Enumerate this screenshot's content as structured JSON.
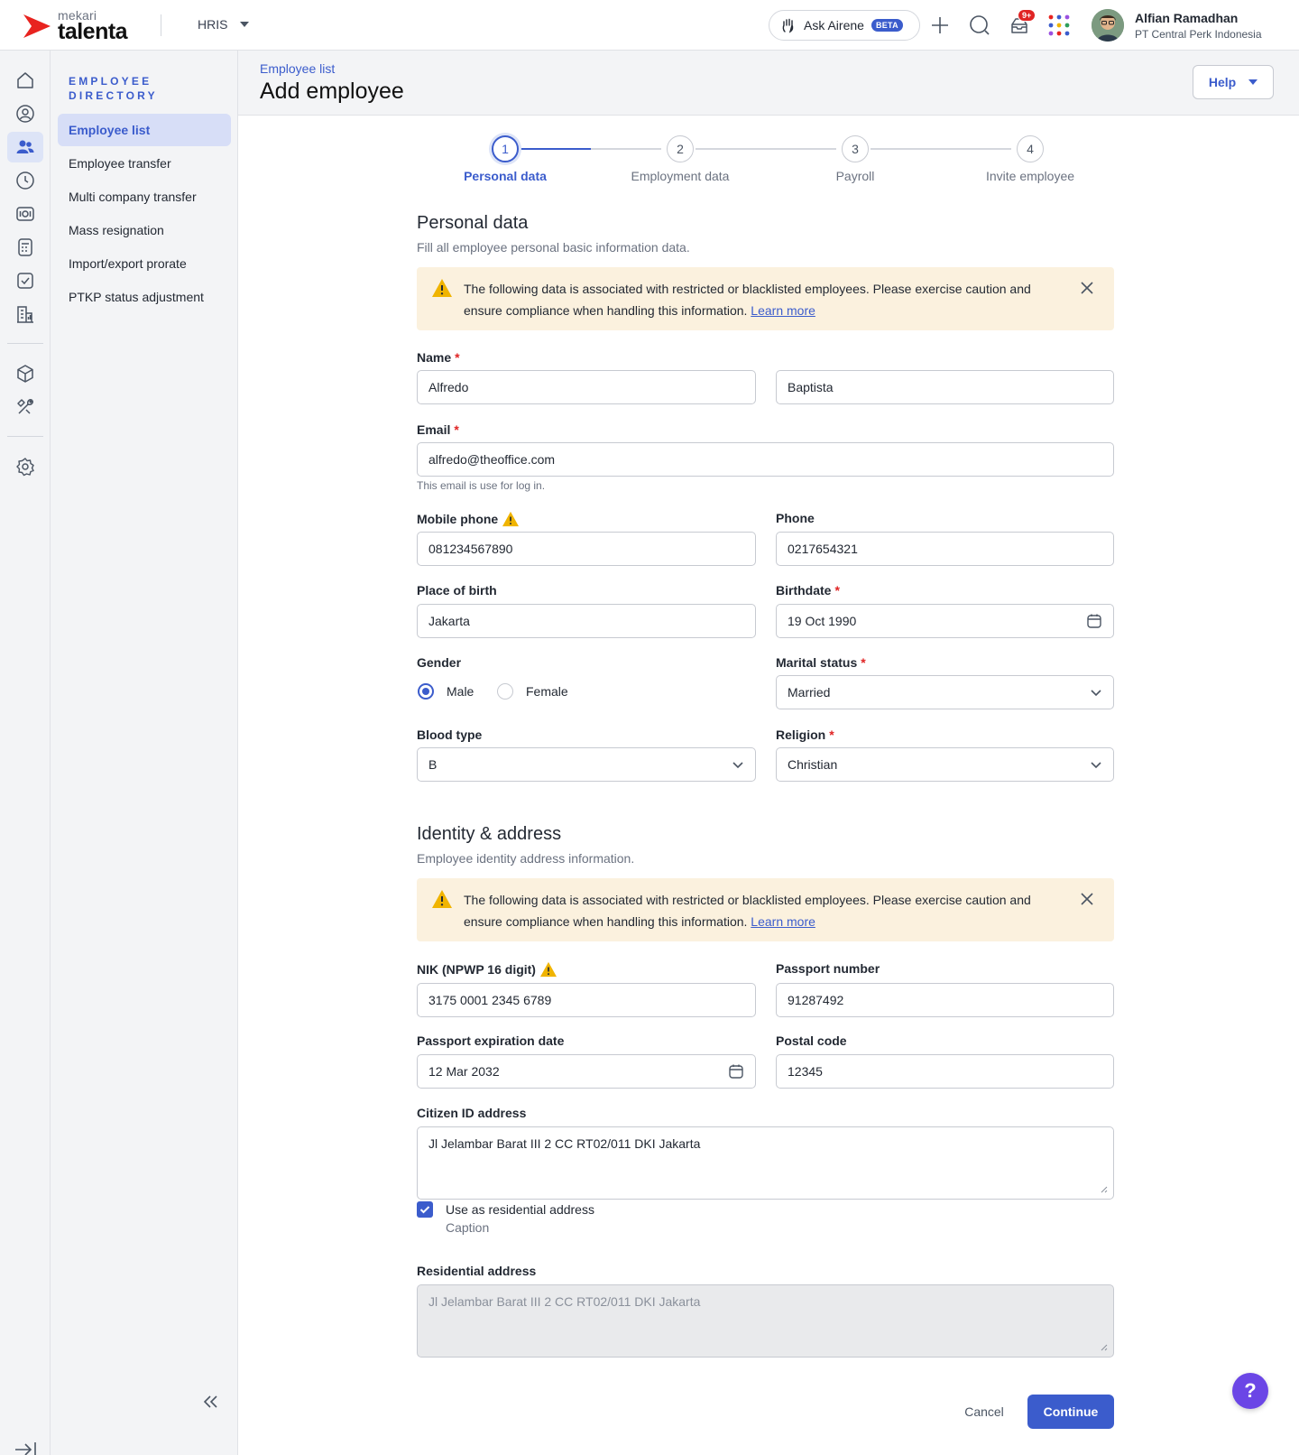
{
  "topbar": {
    "brand_small": "mekari",
    "brand_big": "talenta",
    "module": "HRIS",
    "ask_label": "Ask Airene",
    "ask_badge": "BETA",
    "notif_count": "9+",
    "user_name": "Alfian Ramadhan",
    "user_company": "PT Central Perk Indonesia"
  },
  "rail": {
    "icons": [
      "home-icon",
      "user-circle-icon",
      "users-icon",
      "clock-icon",
      "money-icon",
      "calculator-icon",
      "checklist-icon",
      "building-chart-icon",
      "box-icon",
      "tools-icon",
      "gear-icon"
    ],
    "active": "users-icon"
  },
  "subnav": {
    "title": "EMPLOYEE DIRECTORY",
    "items": [
      {
        "label": "Employee list",
        "active": true
      },
      {
        "label": "Employee transfer"
      },
      {
        "label": "Multi company transfer"
      },
      {
        "label": "Mass resignation"
      },
      {
        "label": "Import/export prorate"
      },
      {
        "label": "PTKP status adjustment"
      }
    ]
  },
  "header": {
    "breadcrumb": "Employee list",
    "title": "Add employee",
    "help_label": "Help"
  },
  "stepper": [
    {
      "num": "1",
      "label": "Personal data",
      "active": true
    },
    {
      "num": "2",
      "label": "Employment data"
    },
    {
      "num": "3",
      "label": "Payroll"
    },
    {
      "num": "4",
      "label": "Invite employee"
    }
  ],
  "personal": {
    "title": "Personal data",
    "subtitle": "Fill all employee personal basic information data.",
    "alert_text": "The following data is associated with restricted or blacklisted employees. Please exercise caution and ensure compliance when handling this information.",
    "alert_link": "Learn more",
    "name_label": "Name",
    "first_name": "Alfredo",
    "last_name": "Baptista",
    "email_label": "Email",
    "email": "alfredo@theoffice.com",
    "email_hint": "This email is use for log in.",
    "mobile_label": "Mobile phone",
    "mobile": "081234567890",
    "phone_label": "Phone",
    "phone": "0217654321",
    "pob_label": "Place of birth",
    "pob": "Jakarta",
    "birthdate_label": "Birthdate",
    "birthdate": "19 Oct 1990",
    "gender_label": "Gender",
    "gender_options": [
      "Male",
      "Female"
    ],
    "gender_selected": "Male",
    "marital_label": "Marital status",
    "marital": "Married",
    "blood_label": "Blood type",
    "blood": "B",
    "religion_label": "Religion",
    "religion": "Christian"
  },
  "identity": {
    "title": "Identity & address",
    "subtitle": "Employee identity address information.",
    "alert_text": "The following data is associated with restricted or blacklisted employees. Please exercise caution and ensure compliance when handling this information.",
    "alert_link": "Learn more",
    "nik_label": "NIK (NPWP 16 digit)",
    "nik": "3175 0001 2345 6789",
    "passport_label": "Passport number",
    "passport": "91287492",
    "passport_exp_label": "Passport expiration date",
    "passport_exp": "12 Mar 2032",
    "postal_label": "Postal code",
    "postal": "12345",
    "citizen_addr_label": "Citizen ID address",
    "citizen_addr": "Jl Jelambar Barat III 2 CC RT02/011 DKI Jakarta",
    "use_residential_label": "Use as residential address",
    "use_residential_caption": "Caption",
    "use_residential_checked": true,
    "residential_label": "Residential address",
    "residential_addr": "Jl Jelambar Barat III 2 CC RT02/011 DKI Jakarta"
  },
  "actions": {
    "cancel": "Cancel",
    "continue": "Continue",
    "fab": "?"
  },
  "colors": {
    "primary": "#3b5ccc",
    "alert_bg": "#fbf1de",
    "warning": "#f0b400",
    "required": "#e02424",
    "brand_red": "#e8231f"
  }
}
